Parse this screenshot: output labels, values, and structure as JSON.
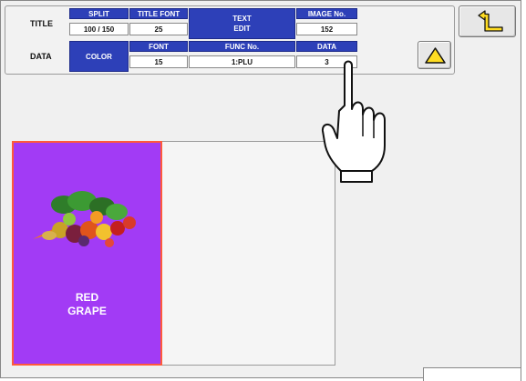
{
  "title_row": {
    "label": "TITLE",
    "split_header": "SPLIT",
    "split_value": "100 / 150",
    "title_font_header": "TITLE FONT",
    "title_font_value": "25",
    "text_edit_line1": "TEXT",
    "text_edit_line2": "EDIT",
    "image_no_header": "IMAGE No.",
    "image_no_value": "152"
  },
  "data_row": {
    "label": "DATA",
    "color_label": "COLOR",
    "font_header": "FONT",
    "font_value": "15",
    "func_no_header": "FUNC No.",
    "func_no_value": "1:PLU",
    "data_header": "DATA",
    "data_value": "3"
  },
  "buttons": {
    "back_icon": "return-arrow-icon",
    "up_icon": "up-triangle-icon"
  },
  "key": {
    "label": "RED\nGRAPE",
    "color": "#a23bf5",
    "border_color": "#ff5a3a",
    "image_icon": "vegetables-icon"
  },
  "hand_icon": "pointing-hand-icon",
  "colors": {
    "header_blue": "#2d40b8",
    "up_triangle": "#ffdd22"
  }
}
